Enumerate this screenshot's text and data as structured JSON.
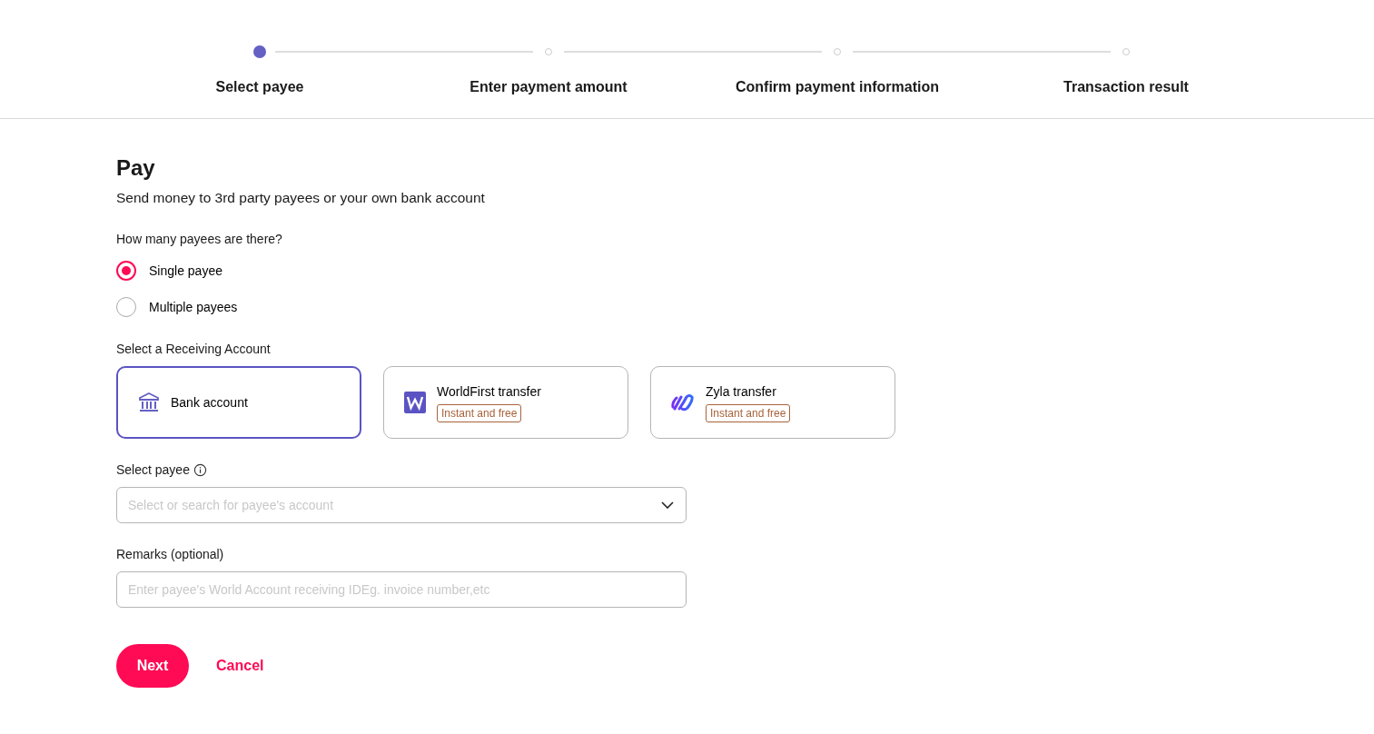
{
  "steps": [
    {
      "label": "Select payee",
      "selected": true
    },
    {
      "label": "Enter payment amount",
      "selected": false
    },
    {
      "label": "Confirm payment information",
      "selected": false
    },
    {
      "label": "Transaction result",
      "selected": false
    }
  ],
  "title": "Pay",
  "subtitle": "Send money to 3rd party payees or your own bank account",
  "payee_count": {
    "label": "How many payees are there?",
    "options": [
      {
        "label": "Single payee",
        "selected": true
      },
      {
        "label": "Multiple payees",
        "selected": false
      }
    ]
  },
  "receiving_account": {
    "label": "Select a Receiving Account",
    "options": [
      {
        "kind": "bank",
        "label": "Bank account",
        "selected": true
      },
      {
        "kind": "worldfirst",
        "label": "WorldFirst transfer",
        "badge": "Instant and free",
        "selected": false
      },
      {
        "kind": "zyla",
        "label": "Zyla transfer",
        "badge": "Instant and free",
        "selected": false
      }
    ]
  },
  "select_payee": {
    "label": "Select payee",
    "placeholder": "Select or search for payee's account"
  },
  "remarks": {
    "label": "Remarks (optional)",
    "placeholder": "Enter payee's World Account receiving IDEg. invoice number,etc"
  },
  "buttons": {
    "primary": "Next",
    "secondary": "Cancel"
  }
}
